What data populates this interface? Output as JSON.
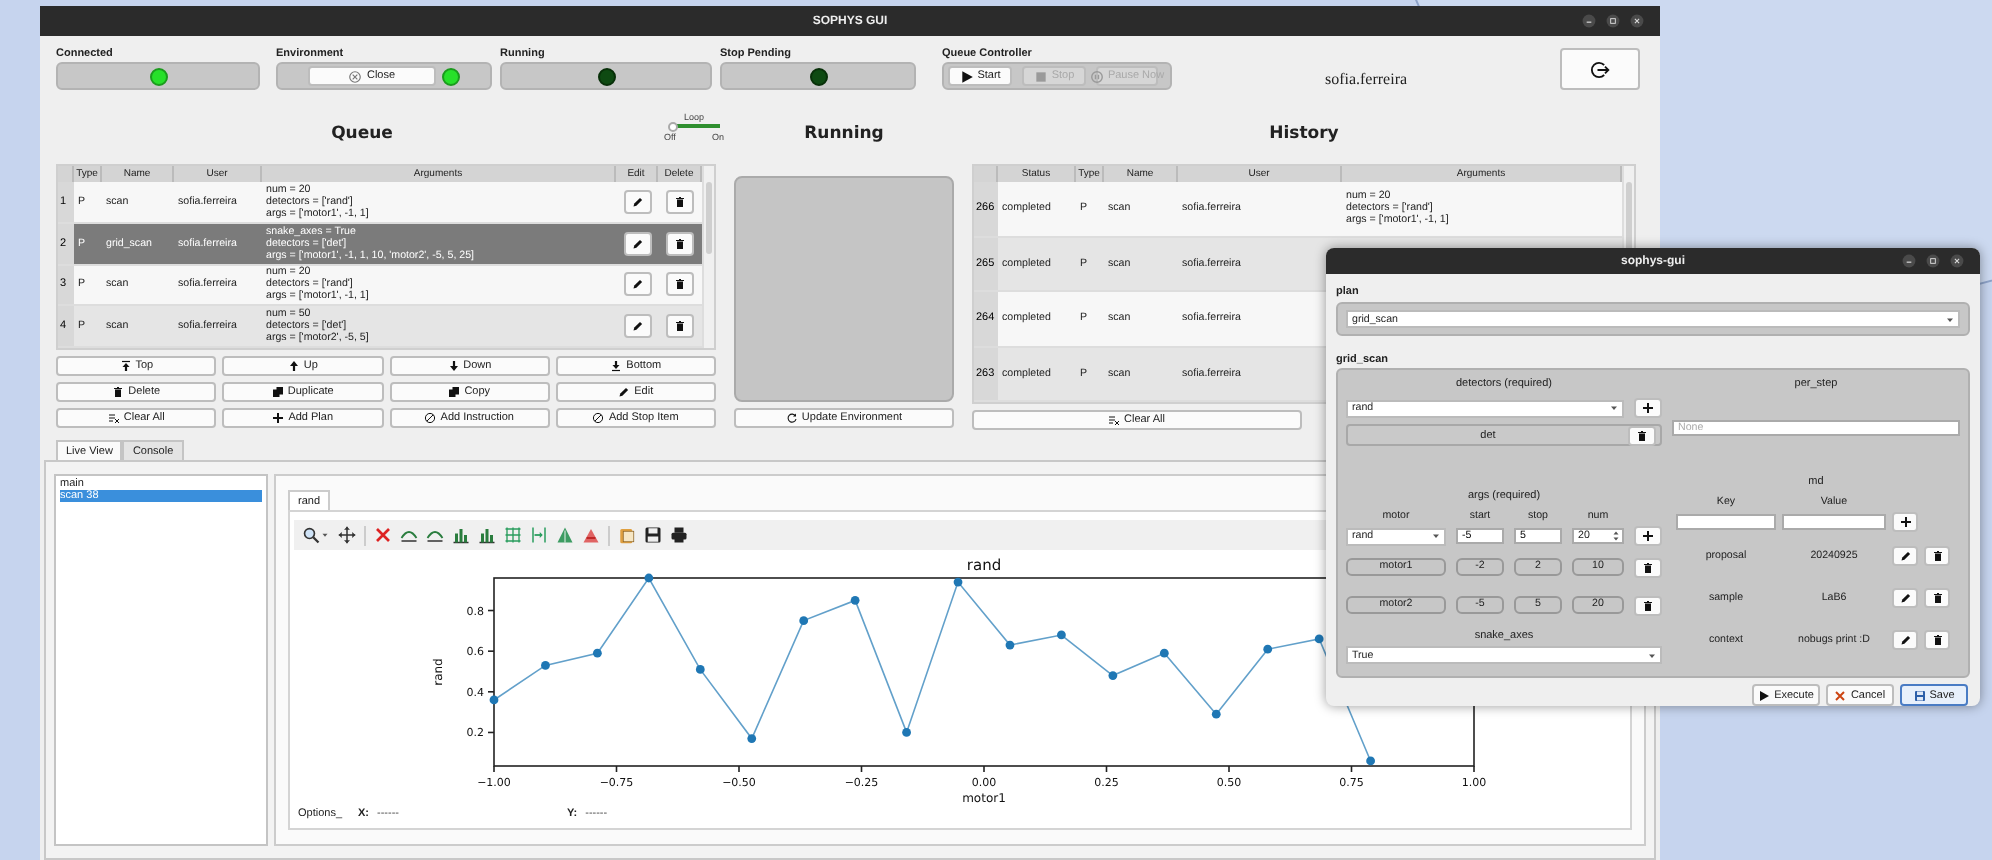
{
  "window": {
    "title": "SOPHYS GUI"
  },
  "status": [
    {
      "label": "Connected",
      "on": true
    },
    {
      "label": "Environment",
      "on": true,
      "button": "Close"
    },
    {
      "label": "Running",
      "on": false
    },
    {
      "label": "Stop Pending",
      "on": false
    }
  ],
  "queue_controller": {
    "label": "Queue Controller",
    "buttons": [
      {
        "label": "Start",
        "disabled": false
      },
      {
        "label": "Stop",
        "disabled": true
      },
      {
        "label": "Pause Now",
        "disabled": true
      }
    ]
  },
  "user": "sofia.ferreira",
  "queue": {
    "title": "Queue",
    "loop": {
      "label": "Loop",
      "on": false,
      "off_label": "Off",
      "on_label": "On"
    },
    "columns": [
      "Type",
      "Name",
      "User",
      "Arguments",
      "Edit",
      "Delete"
    ],
    "rows": [
      {
        "index": "1",
        "type": "P",
        "name": "scan",
        "user": "sofia.ferreira",
        "arguments": [
          "num = 20",
          "detectors = ['rand']",
          "args = ['motor1', -1, 1]"
        ],
        "selected": false
      },
      {
        "index": "2",
        "type": "P",
        "name": "grid_scan",
        "user": "sofia.ferreira",
        "arguments": [
          "snake_axes = True",
          "detectors = ['det']",
          "args = ['motor1', -1, 1, 10, 'motor2', -5, 5, 25]"
        ],
        "selected": true
      },
      {
        "index": "3",
        "type": "P",
        "name": "scan",
        "user": "sofia.ferreira",
        "arguments": [
          "num = 20",
          "detectors = ['rand']",
          "args = ['motor1', -1, 1]"
        ],
        "selected": false
      },
      {
        "index": "4",
        "type": "P",
        "name": "scan",
        "user": "sofia.ferreira",
        "arguments": [
          "num = 50",
          "detectors = ['det']",
          "args = ['motor2', -5, 5]"
        ],
        "selected": false
      }
    ],
    "buttons": [
      "Top",
      "Up",
      "Down",
      "Bottom",
      "Delete",
      "Duplicate",
      "Copy",
      "Edit",
      "Clear All",
      "Add Plan",
      "Add Instruction",
      "Add Stop Item"
    ]
  },
  "running": {
    "title": "Running",
    "button": "Update Environment"
  },
  "history": {
    "title": "History",
    "columns": [
      "Status",
      "Type",
      "Name",
      "User",
      "Arguments"
    ],
    "rows": [
      {
        "index": "266",
        "status": "completed",
        "type": "P",
        "name": "scan",
        "user": "sofia.ferreira",
        "arguments": [
          "num = 20",
          "detectors = ['rand']",
          "args = ['motor1', -1, 1]"
        ]
      },
      {
        "index": "265",
        "status": "completed",
        "type": "P",
        "name": "scan",
        "user": "sofia.ferreira"
      },
      {
        "index": "264",
        "status": "completed",
        "type": "P",
        "name": "scan",
        "user": "sofia.ferreira"
      },
      {
        "index": "263",
        "status": "completed",
        "type": "P",
        "name": "scan",
        "user": "sofia.ferreira"
      }
    ],
    "buttons": [
      "Clear All"
    ]
  },
  "tabs": [
    {
      "label": "Live View",
      "selected": true
    },
    {
      "label": "Console",
      "selected": false
    }
  ],
  "runs": [
    {
      "label": "main",
      "selected": false
    },
    {
      "label": "scan 38",
      "selected": true
    }
  ],
  "plot_tabs": [
    {
      "label": "rand",
      "selected": true
    }
  ],
  "chart_data": {
    "type": "line",
    "title": "rand",
    "xlabel": "motor1",
    "ylabel": "rand",
    "x": [
      -1.0,
      -0.895,
      -0.789,
      -0.684,
      -0.579,
      -0.474,
      -0.368,
      -0.263,
      -0.158,
      -0.053,
      0.053,
      0.158,
      0.263,
      0.368,
      0.474,
      0.579,
      0.684,
      0.789
    ],
    "series": [
      {
        "color": "#1f77b4",
        "marker": "o",
        "values": [
          0.36,
          0.53,
          0.59,
          0.96,
          0.51,
          0.17,
          0.75,
          0.85,
          0.2,
          0.94,
          0.63,
          0.68,
          0.48,
          0.59,
          0.29,
          0.61,
          0.66,
          0.06
        ]
      }
    ],
    "xlim": [
      -1,
      1
    ],
    "ylim": [
      0.035,
      0.96
    ],
    "xticks": [
      {
        "value": -1,
        "label": "−1.00"
      },
      {
        "value": -0.75,
        "label": "−0.75"
      },
      {
        "value": -0.5,
        "label": "−0.50"
      },
      {
        "value": -0.25,
        "label": "−0.25"
      },
      {
        "value": 0,
        "label": "0.00"
      },
      {
        "value": 0.25,
        "label": "0.25"
      },
      {
        "value": 0.5,
        "label": "0.50"
      },
      {
        "value": 0.75,
        "label": "0.75"
      },
      {
        "value": 1,
        "label": "1.00"
      }
    ],
    "yticks": [
      {
        "value": 0.2,
        "label": "0.2"
      },
      {
        "value": 0.4,
        "label": "0.4"
      },
      {
        "value": 0.6,
        "label": "0.6"
      },
      {
        "value": 0.8,
        "label": "0.8"
      }
    ]
  },
  "options": {
    "label": "Options_",
    "x_label": "X:",
    "x_value": "------",
    "y_label": "Y:",
    "y_value": "------"
  },
  "dialog": {
    "title": "sophys-gui",
    "plan_label": "plan",
    "plan": "grid_scan",
    "group_label": "grid_scan",
    "detectors": {
      "label": "detectors (required)",
      "value": "rand",
      "items": [
        "det"
      ]
    },
    "per_step": {
      "label": "per_step",
      "placeholder": "None"
    },
    "args": {
      "label": "args (required)",
      "columns": [
        "motor",
        "start",
        "stop",
        "num"
      ],
      "input": {
        "motor": "rand",
        "start": "-5",
        "stop": "5",
        "num": "20"
      },
      "rows": [
        {
          "motor": "motor1",
          "start": "-2",
          "stop": "2",
          "num": "10"
        },
        {
          "motor": "motor2",
          "start": "-5",
          "stop": "5",
          "num": "20"
        }
      ]
    },
    "snake_axes": {
      "label": "snake_axes",
      "value": "True"
    },
    "md": {
      "label": "md",
      "columns": [
        "Key",
        "Value"
      ],
      "rows": [
        {
          "key": "proposal",
          "value": "20240925"
        },
        {
          "key": "sample",
          "value": "LaB6"
        },
        {
          "key": "context",
          "value": "nobugs print :D"
        }
      ]
    },
    "buttons": [
      "Execute",
      "Cancel",
      "Save"
    ]
  }
}
